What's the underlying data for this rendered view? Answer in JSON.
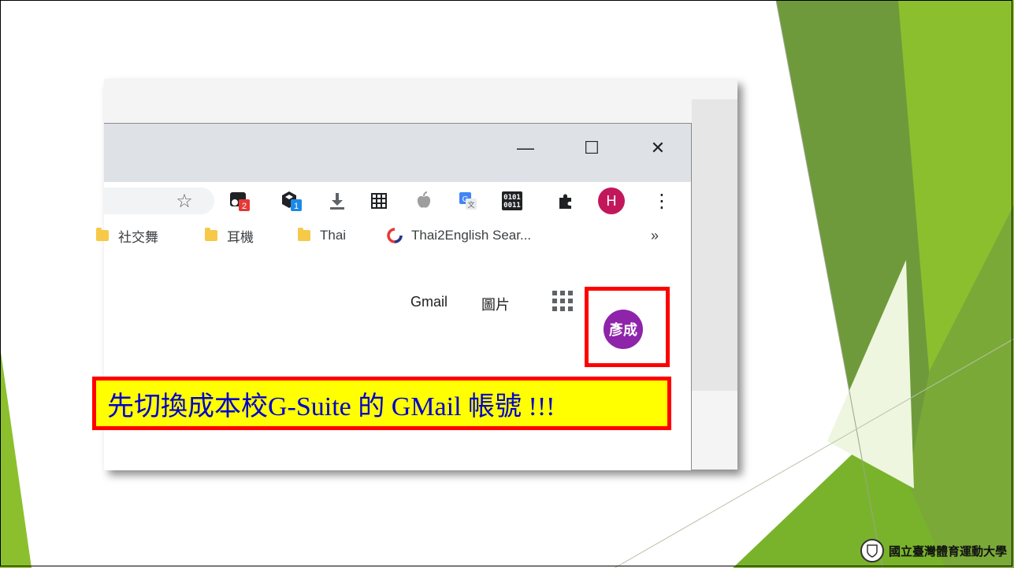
{
  "window_controls": {
    "minimize": "—",
    "maximize": "☐",
    "close": "✕"
  },
  "toolbar": {
    "star": "☆",
    "ext1_badge": "2",
    "ext2_badge": "1",
    "binary_top": "0101",
    "binary_bottom": "0011",
    "profile_initial": "H",
    "menu": "⋮",
    "ext_colors": {
      "ext1_badge": "#e53935",
      "ext2_badge": "#1e88e5",
      "profile": "#c2185b"
    }
  },
  "bookmarks": {
    "items": [
      {
        "label": "社交舞"
      },
      {
        "label": "耳機"
      },
      {
        "label": "Thai"
      },
      {
        "label": "Thai2English Sear..."
      }
    ],
    "more": "»"
  },
  "google_bar": {
    "gmail": "Gmail",
    "images": "圖片",
    "avatar_text": "彥成",
    "avatar_color": "#8e24aa"
  },
  "callout": {
    "text": "先切換成本校G-Suite 的 GMail 帳號 !!!",
    "bg_color": "#ffff00",
    "border_color": "#ff0000",
    "text_color": "#0000cc"
  },
  "logo": {
    "name": "國立臺灣體育運動大學"
  },
  "theme": {
    "green_dark": "#6f9a3b",
    "green_mid": "#8cbf2e",
    "green_light": "#c9e39a"
  }
}
